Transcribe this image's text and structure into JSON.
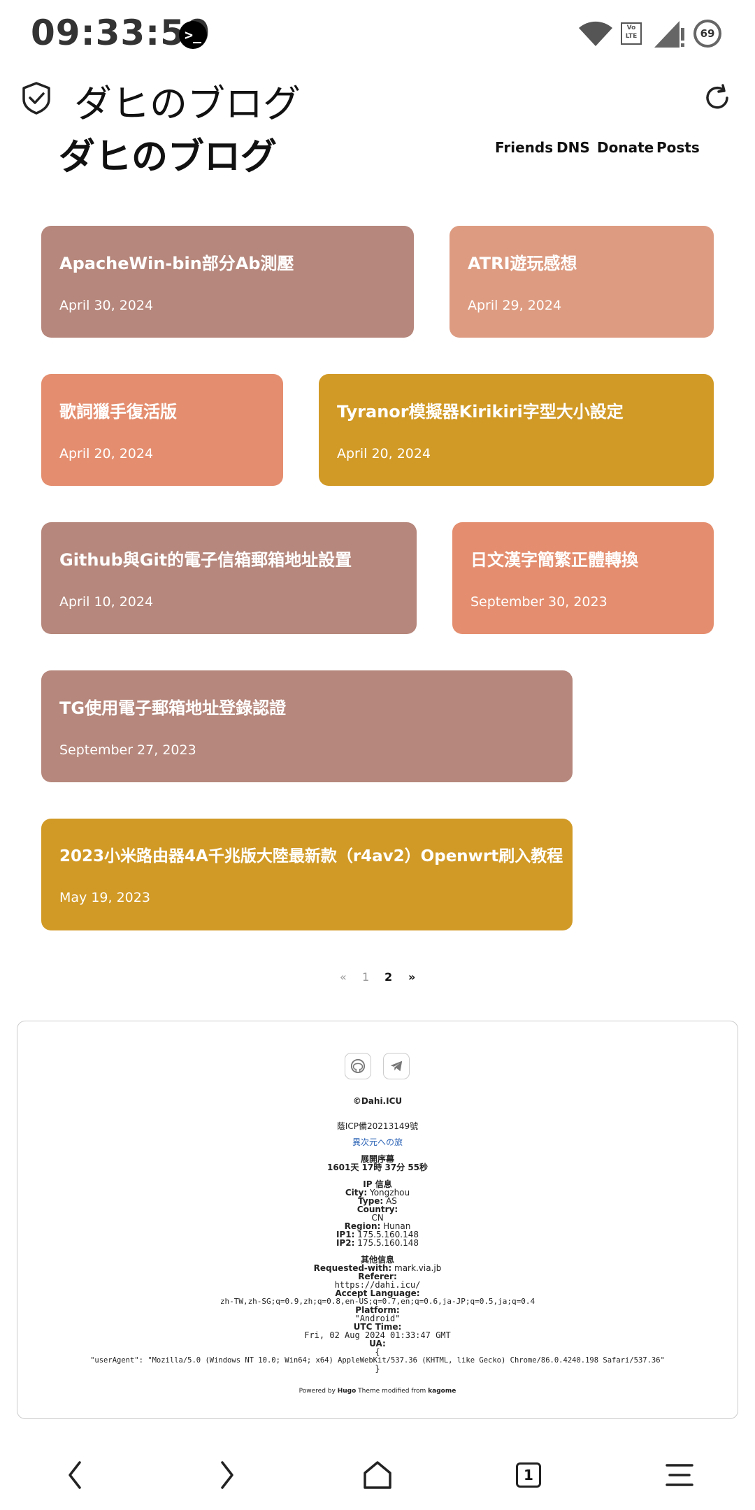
{
  "status_bar": {
    "time": "09:33:50",
    "terminal_glyph": ">_",
    "network_label": "Vo LTE",
    "battery": "69"
  },
  "browser": {
    "tab_title": "ダヒのブログ"
  },
  "site": {
    "title": "ダヒのブログ",
    "nav": [
      "Friends",
      "DNS",
      "Donate",
      "Posts"
    ]
  },
  "posts": [
    {
      "title": "ApacheWin-bin部分Ab測壓",
      "date": "April 30, 2024"
    },
    {
      "title": "ATRI遊玩感想",
      "date": "April 29, 2024"
    },
    {
      "title": "歌詞獵手復活版",
      "date": "April 20, 2024"
    },
    {
      "title": "Tyranor模擬器Kirikiri字型大小設定",
      "date": "April 20, 2024"
    },
    {
      "title": "Github與Git的電子信箱郵箱地址設置",
      "date": "April 10, 2024"
    },
    {
      "title": "日文漢字簡繁正體轉換",
      "date": "September 30, 2023"
    },
    {
      "title": "TG使用電子郵箱地址登錄認證",
      "date": "September 27, 2023"
    },
    {
      "title": "2023小米路由器4A千兆版大陸最新款（r4av2）Openwrt刷入教程",
      "date": "May 19, 2023"
    }
  ],
  "pagination": {
    "prev": "«",
    "pages": [
      "1",
      "2"
    ],
    "current": "2",
    "next": "»"
  },
  "footer": {
    "copyright": "©Dahi.ICU",
    "icp": "蔭ICP備20213149號",
    "link": "異次元への旅",
    "uptime_label": "展開序幕",
    "uptime": "1601天 17時 37分 55秒",
    "ip_header": "IP 信息",
    "city_label": "City:",
    "city": "Yongzhou",
    "type_label": "Type:",
    "type": "AS",
    "country_label": "Country:",
    "country": "CN",
    "region_label": "Region:",
    "region": "Hunan",
    "ip1_label": "IP1:",
    "ip1": "175.5.160.148",
    "ip2_label": "IP2:",
    "ip2": "175.5.160.148",
    "other_header": "其他信息",
    "requested_label": "Requested-with:",
    "requested": "mark.via.jb",
    "referer_label": "Referer:",
    "referer": "https://dahi.icu/",
    "lang_label": "Accept Language:",
    "lang": "zh-TW,zh-SG;q=0.9,zh;q=0.8,en-US;q=0.7,en;q=0.6,ja-JP;q=0.5,ja;q=0.4",
    "platform_label": "Platform:",
    "platform": "\"Android\"",
    "utc_label": "UTC Time:",
    "utc": "Fri, 02 Aug 2024 01:33:47 GMT",
    "ua_label": "UA:",
    "ua_open": "{",
    "ua": "\"userAgent\": \"Mozilla/5.0 (Windows NT 10.0; Win64; x64) AppleWebKit/537.36 (KHTML, like Gecko) Chrome/86.0.4240.198 Safari/537.36\"",
    "ua_close": "}",
    "powered_by": "Powered by",
    "hugo": "Hugo",
    "theme_text": "Theme modified from",
    "kagome": "kagome"
  },
  "colors": {
    "card_brown": "#b6877c",
    "card_peach": "#dd9c82",
    "card_coral": "#e48e6f",
    "card_gold": "#d19a26",
    "link": "#2a62b5"
  },
  "icons": {
    "browser_left": "shield-check-icon",
    "browser_right": "refresh-icon",
    "footer": [
      "github-icon",
      "telegram-icon"
    ],
    "bottom_nav": [
      "back-icon",
      "forward-icon",
      "home-icon",
      "tabs-icon",
      "menu-icon"
    ]
  },
  "tab_count": "1"
}
